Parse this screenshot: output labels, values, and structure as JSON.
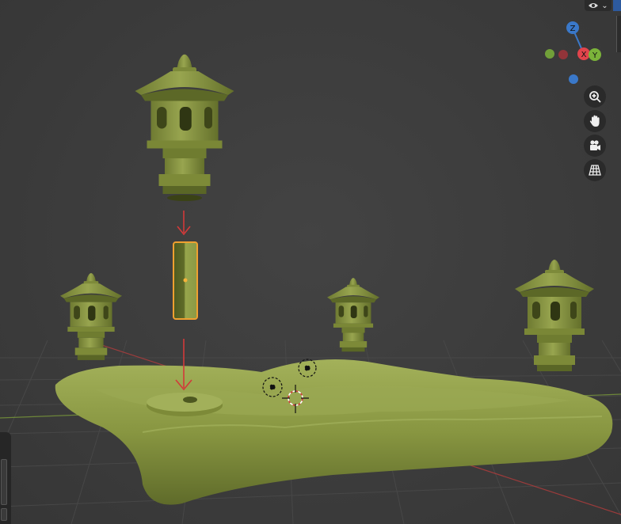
{
  "viewport": {
    "background": "#3d3d3d",
    "grid_color": "#4a4a4a",
    "x_axis_color": "#b43c3c",
    "y_axis_color": "#7a9a3a",
    "model_color": "#8c9a45",
    "selection_outline": "#f0a030",
    "annotation_arrow_color": "#d23a3a"
  },
  "gizmo": {
    "z_label": "Z",
    "x_label": "X",
    "y_label": "Y",
    "z_color": "#3a78c9",
    "x_color": "#e2444c",
    "y_color": "#7bb33a"
  },
  "nav_buttons": [
    {
      "name": "zoom",
      "icon": "zoom-in-icon"
    },
    {
      "name": "pan",
      "icon": "hand-icon"
    },
    {
      "name": "camera",
      "icon": "camera-icon"
    },
    {
      "name": "perspective",
      "icon": "grid-icon"
    }
  ],
  "top_widget": {
    "icon": "eye-icon",
    "caret": "⌄"
  }
}
